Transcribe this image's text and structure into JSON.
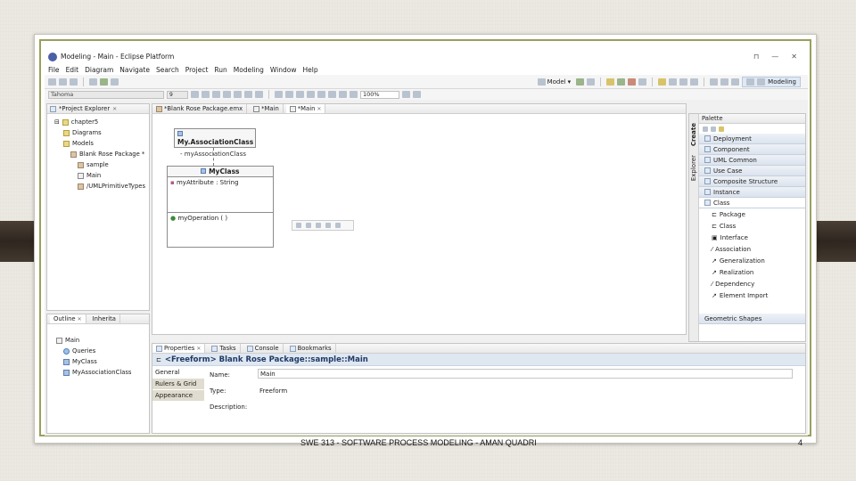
{
  "window": {
    "title": "Modeling - Main - Eclipse Platform",
    "controls": [
      "⊓",
      "—",
      "✕"
    ]
  },
  "menu": [
    "File",
    "Edit",
    "Diagram",
    "Navigate",
    "Search",
    "Project",
    "Run",
    "Modeling",
    "Window",
    "Help"
  ],
  "toolbar": {
    "model_label": "Model",
    "perspective_label": "Modeling",
    "font": "Tahoma",
    "font_size": "9",
    "zoom": "100%"
  },
  "project_explorer": {
    "tab_label": "*Project Explorer",
    "items": [
      {
        "label": "chapter5",
        "level": 1
      },
      {
        "label": "Diagrams",
        "level": 2
      },
      {
        "label": "Models",
        "level": 2
      },
      {
        "label": "Blank Rose Package *",
        "level": 3
      },
      {
        "label": "sample",
        "level": 4
      },
      {
        "label": "Main",
        "level": 4
      },
      {
        "label": "/UMLPrimitiveTypes",
        "level": 4
      }
    ]
  },
  "outline": {
    "tabs": [
      "Outline",
      "Inherita"
    ],
    "items": [
      {
        "label": "Main",
        "level": 1
      },
      {
        "label": "Queries",
        "level": 2
      },
      {
        "label": "MyClass",
        "level": 2
      },
      {
        "label": "MyAssociationClass",
        "level": 2
      }
    ]
  },
  "editor": {
    "tabs": [
      "*Blank Rose Package.emx",
      "*Main",
      "*Main"
    ],
    "diagram": {
      "assoc_class": {
        "name": "My.AssociationClass",
        "attribute": "- myAssociationClass"
      },
      "my_class": {
        "name": "MyClass",
        "attribute": "myAttribute : String",
        "operation": "myOperation ( )"
      }
    }
  },
  "palette": {
    "title": "Palette",
    "side_tabs": [
      "Create",
      "Explorer"
    ],
    "drawers": [
      "Deployment",
      "Component",
      "UML Common",
      "Use Case",
      "Composite Structure",
      "Instance",
      "Class"
    ],
    "class_tools": [
      "Package",
      "Class",
      "Interface",
      "Association",
      "Generalization",
      "Realization",
      "Dependency",
      "Element Import"
    ],
    "bottom_drawer": "Geometric Shapes"
  },
  "properties": {
    "tabs": [
      "Properties",
      "Tasks",
      "Console",
      "Bookmarks"
    ],
    "header": "<Freeform> Blank Rose Package::sample::Main",
    "sections": [
      "General",
      "Rulers & Grid",
      "Appearance"
    ],
    "fields": [
      {
        "label": "Name:",
        "value": "Main"
      },
      {
        "label": "Type:",
        "value": "Freeform"
      },
      {
        "label": "Description:",
        "value": ""
      }
    ]
  },
  "slide": {
    "footer": "SWE 313 - SOFTWARE PROCESS MODELING - AMAN QUADRI",
    "page_number": "4"
  },
  "colors": {
    "frame_border": "#9aa05b",
    "palette_header": "#dbe3ee"
  }
}
